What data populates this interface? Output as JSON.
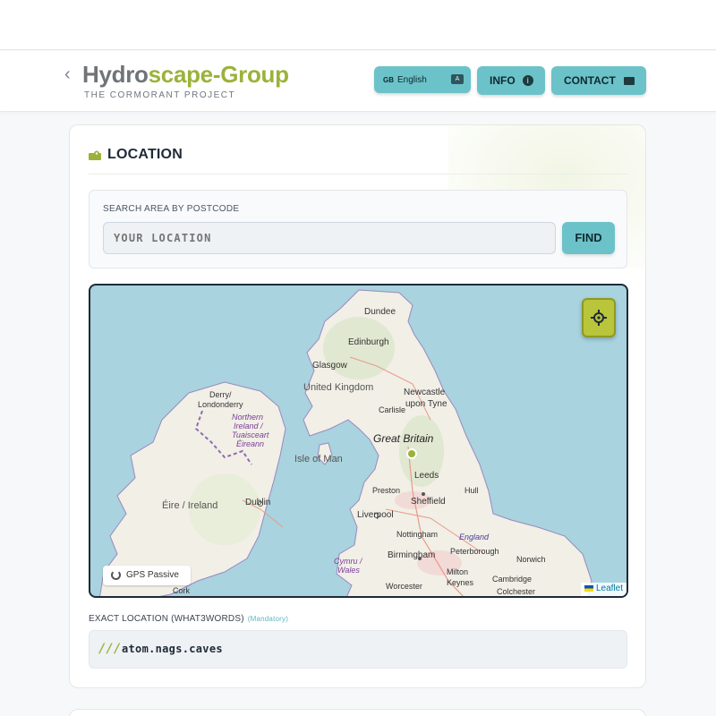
{
  "header": {
    "brand_part1": "Hydro",
    "brand_part2": "scape-Group",
    "subtitle": "THE CORMORANT PROJECT",
    "language_button": {
      "flag": "GB",
      "label": "English"
    },
    "info_label": "INFO",
    "contact_label": "CONTACT"
  },
  "location": {
    "title": "LOCATION",
    "search": {
      "label": "SEARCH AREA BY POSTCODE",
      "placeholder": "YOUR LOCATION",
      "find_label": "FIND"
    },
    "map": {
      "labels": [
        {
          "key": "dundee",
          "text": "Dundee"
        },
        {
          "key": "edinburgh",
          "text": "Edinburgh"
        },
        {
          "key": "glasgow",
          "text": "Glasgow"
        },
        {
          "key": "uk",
          "text": "United Kingdom"
        },
        {
          "key": "newcastle1",
          "text": "Newcastle"
        },
        {
          "key": "newcastle2",
          "text": "upon Tyne"
        },
        {
          "key": "derry1",
          "text": "Derry/"
        },
        {
          "key": "derry2",
          "text": "Londonderry"
        },
        {
          "key": "carlisle",
          "text": "Carlisle"
        },
        {
          "key": "greatbritain",
          "text": "Great Britain"
        },
        {
          "key": "ni1",
          "text": "Northern"
        },
        {
          "key": "ni2",
          "text": "Ireland /"
        },
        {
          "key": "ni3",
          "text": "Tuaisceart"
        },
        {
          "key": "ni4",
          "text": "Éireann"
        },
        {
          "key": "isleofman",
          "text": "Isle of Man"
        },
        {
          "key": "leeds",
          "text": "Leeds"
        },
        {
          "key": "hull",
          "text": "Hull"
        },
        {
          "key": "preston",
          "text": "Preston"
        },
        {
          "key": "sheffield",
          "text": "Sheffield"
        },
        {
          "key": "eire",
          "text": "Éire / Ireland"
        },
        {
          "key": "dublin",
          "text": "Dublin"
        },
        {
          "key": "liverpool",
          "text": "Liverpool"
        },
        {
          "key": "nottingham",
          "text": "Nottingham"
        },
        {
          "key": "england",
          "text": "England"
        },
        {
          "key": "peterborough",
          "text": "Peterborough"
        },
        {
          "key": "norwich",
          "text": "Norwich"
        },
        {
          "key": "birmingham",
          "text": "Birmingham"
        },
        {
          "key": "cymru1",
          "text": "Cymru /"
        },
        {
          "key": "cymru2",
          "text": "Wales"
        },
        {
          "key": "milton1",
          "text": "Milton"
        },
        {
          "key": "milton2",
          "text": "Keynes"
        },
        {
          "key": "cambridge",
          "text": "Cambridge"
        },
        {
          "key": "colchester",
          "text": "Colchester"
        },
        {
          "key": "worcester",
          "text": "Worcester"
        },
        {
          "key": "cork",
          "text": "Cork"
        }
      ],
      "gps_label": "GPS Passive",
      "attribution": "Leaflet",
      "colors": {
        "sea": "#a9d3de",
        "land": "#f1efe6",
        "border": "#8f6bb0"
      }
    },
    "w3w": {
      "label": "EXACT LOCATION (WHAT3WORDS)",
      "mandatory": "(Mandatory)",
      "prefix": "///",
      "value": "atom.nags.caves"
    }
  },
  "colors": {
    "accent": "#6cc2c9",
    "brand_green": "#9bb23a"
  }
}
